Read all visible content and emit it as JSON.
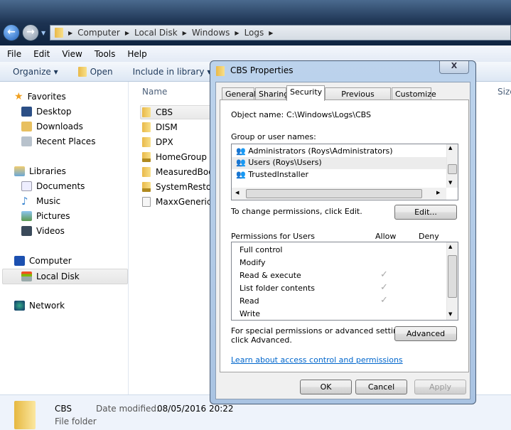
{
  "address": {
    "crumbs": [
      "Computer",
      "Local Disk",
      "Windows",
      "Logs"
    ]
  },
  "menu": [
    "File",
    "Edit",
    "View",
    "Tools",
    "Help"
  ],
  "toolbar": {
    "organize": "Organize ▾",
    "open": "Open",
    "include": "Include in library ▾"
  },
  "sidebar": {
    "favorites": "Favorites",
    "fav_items": [
      "Desktop",
      "Downloads",
      "Recent Places"
    ],
    "libraries": "Libraries",
    "lib_items": [
      "Documents",
      "Music",
      "Pictures",
      "Videos"
    ],
    "computer": "Computer",
    "local_disk": "Local Disk",
    "network": "Network"
  },
  "files": {
    "col_name": "Name",
    "col_size": "Size",
    "items": [
      "CBS",
      "DISM",
      "DPX",
      "HomeGroup",
      "MeasuredBoo",
      "SystemRestore",
      "MaxxGenericIr"
    ]
  },
  "details": {
    "name": "CBS",
    "date_label": "Date modified:",
    "date": "08/05/2016 20:22",
    "type": "File folder"
  },
  "dialog": {
    "title": "CBS Properties",
    "close": "X",
    "tabs": [
      "General",
      "Sharing",
      "Security",
      "Previous Versions",
      "Customize"
    ],
    "active_tab": "Security",
    "object_label": "Object name:",
    "object_value": "C:\\Windows\\Logs\\CBS",
    "groups_label": "Group or user names:",
    "groups": [
      "Administrators (Roys\\Administrators)",
      "Users (Roys\\Users)",
      "TrustedInstaller"
    ],
    "selected_group": "Users (Roys\\Users)",
    "change_text": "To change permissions, click Edit.",
    "edit": "Edit...",
    "perm_label": "Permissions for Users",
    "allow": "Allow",
    "deny": "Deny",
    "permissions": [
      {
        "name": "Full control",
        "allow": false,
        "deny": false
      },
      {
        "name": "Modify",
        "allow": false,
        "deny": false
      },
      {
        "name": "Read & execute",
        "allow": true,
        "deny": false
      },
      {
        "name": "List folder contents",
        "allow": true,
        "deny": false
      },
      {
        "name": "Read",
        "allow": true,
        "deny": false
      },
      {
        "name": "Write",
        "allow": false,
        "deny": false
      }
    ],
    "check": "✓",
    "special_text_1": "For special permissions or advanced settings,",
    "special_text_2": "click Advanced.",
    "advanced": "Advanced",
    "learn": "Learn about access control and permissions",
    "ok": "OK",
    "cancel": "Cancel",
    "apply": "Apply"
  }
}
